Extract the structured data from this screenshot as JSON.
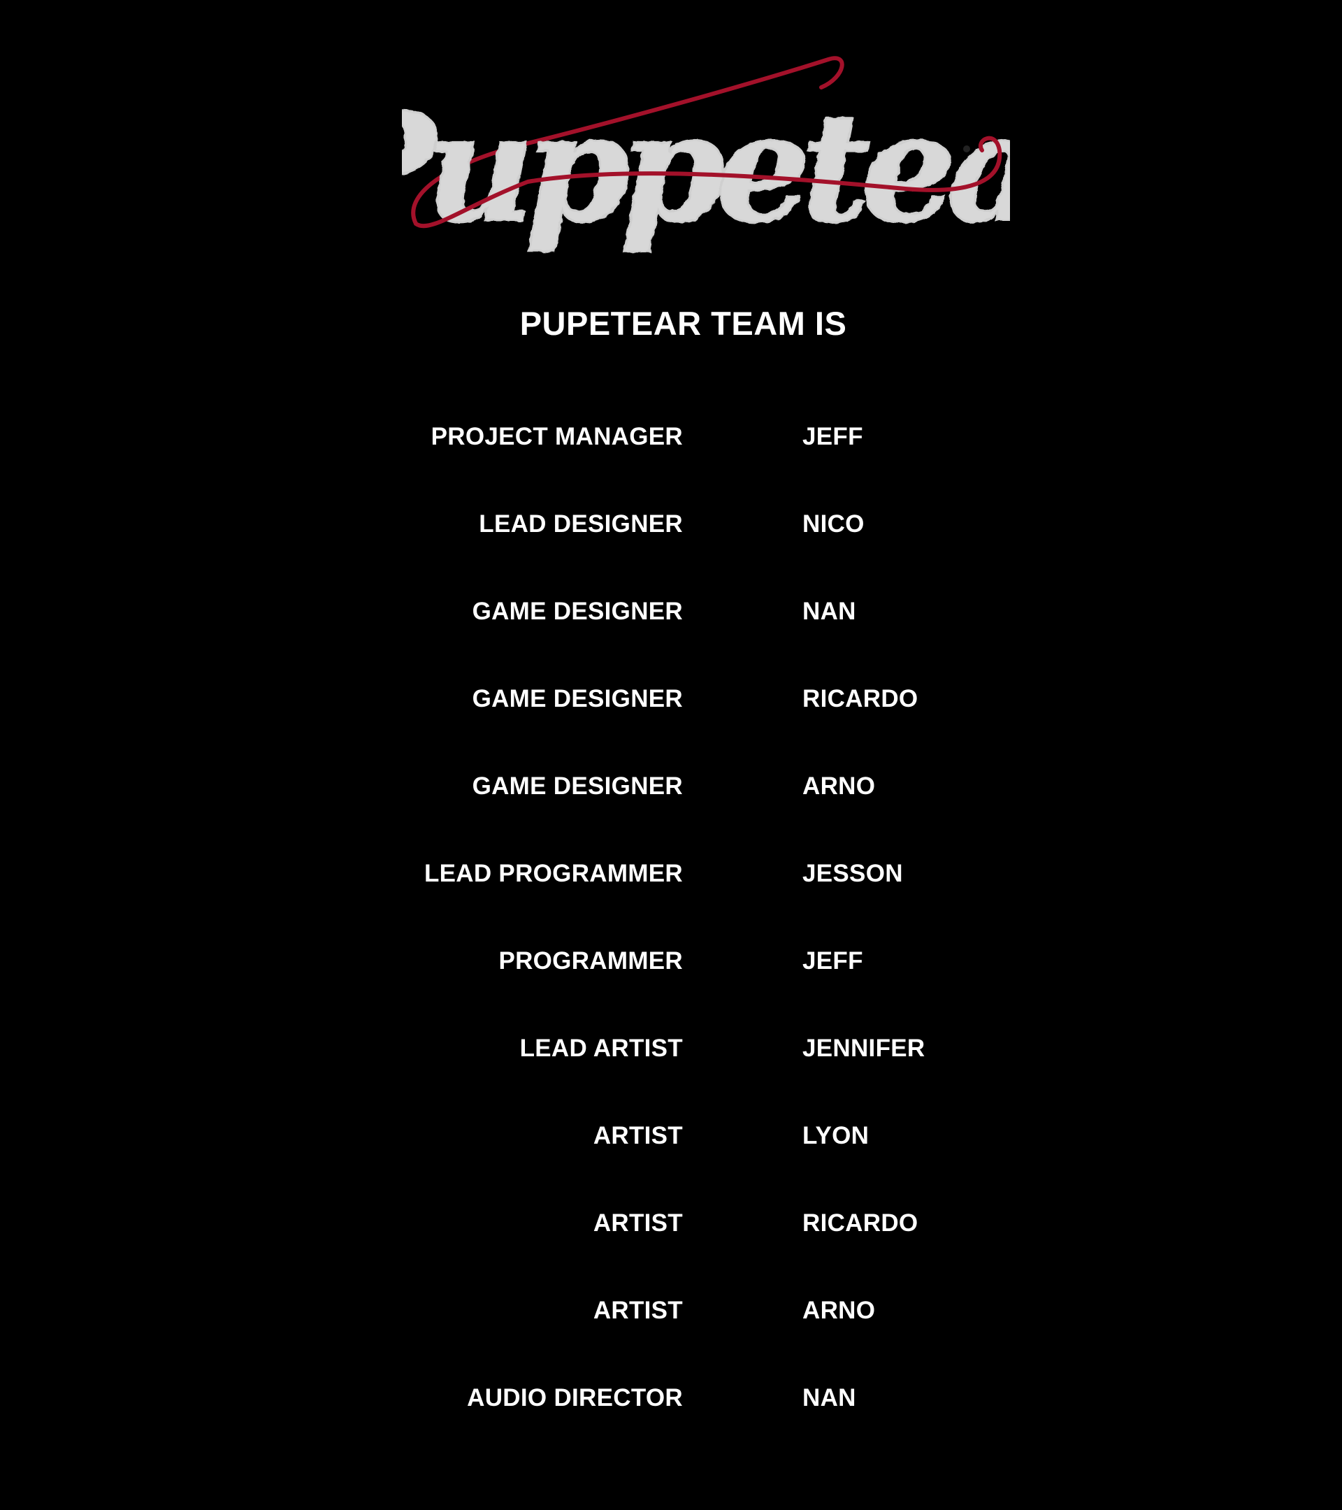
{
  "logo": {
    "text": "Puppetear",
    "colors": {
      "letters": "#d8d8d8",
      "thread": "#a3112a"
    }
  },
  "subtitle": "PUPETEAR TEAM IS",
  "credits": [
    {
      "role": "PROJECT MANAGER",
      "name": "JEFF"
    },
    {
      "role": "LEAD DESIGNER",
      "name": "NICO"
    },
    {
      "role": "GAME DESIGNER",
      "name": "NAN"
    },
    {
      "role": "GAME DESIGNER",
      "name": "RICARDO"
    },
    {
      "role": "GAME DESIGNER",
      "name": "ARNO"
    },
    {
      "role": "LEAD PROGRAMMER",
      "name": "JESSON"
    },
    {
      "role": "PROGRAMMER",
      "name": "JEFF"
    },
    {
      "role": "LEAD ARTIST",
      "name": "JENNIFER"
    },
    {
      "role": "ARTIST",
      "name": "LYON"
    },
    {
      "role": "ARTIST",
      "name": "RICARDO"
    },
    {
      "role": "ARTIST",
      "name": "ARNO"
    },
    {
      "role": "AUDIO DIRECTOR",
      "name": "NAN"
    }
  ]
}
